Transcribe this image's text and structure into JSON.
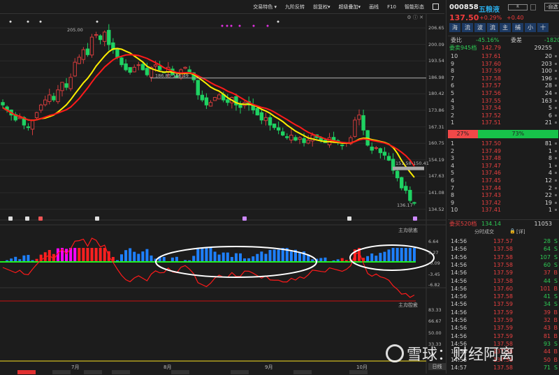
{
  "toolbar": {
    "items": [
      "交易特色 ▾",
      "九阶反转",
      "前复权▾",
      "超级叠加▾",
      "画线",
      "F10",
      "智能形态"
    ]
  },
  "quote": {
    "code": "000858",
    "name": "五粮液",
    "price": "137.50",
    "pct": "+0.29%",
    "change": "+0.40",
    "add_btn": "-自选",
    "btn_r": "R",
    "tabs": [
      "海",
      "流",
      "波",
      "流",
      "主",
      "捕",
      "小",
      "十"
    ],
    "weibi_label": "委比",
    "weibi": "-45.16%",
    "weicha_label": "委差",
    "weicha": "-1820",
    "sell_total_label": "委卖945档",
    "sell_total_price": "142.79",
    "sell_total_vol": "29255",
    "asks": [
      [
        "10",
        "137.61",
        "20"
      ],
      [
        "9",
        "137.60",
        "203"
      ],
      [
        "8",
        "137.59",
        "100"
      ],
      [
        "7",
        "137.58",
        "196"
      ],
      [
        "6",
        "137.57",
        "28"
      ],
      [
        "5",
        "137.56",
        "24"
      ],
      [
        "4",
        "137.55",
        "163"
      ],
      [
        "3",
        "137.54",
        "5"
      ],
      [
        "2",
        "137.52",
        "6"
      ],
      [
        "1",
        "137.51",
        "21"
      ]
    ],
    "ratio_sell": "27%",
    "ratio_buy": "73%",
    "ratio_sell_value": 27,
    "bids": [
      [
        "1",
        "137.50",
        "81"
      ],
      [
        "2",
        "137.49",
        "1"
      ],
      [
        "3",
        "137.48",
        "8"
      ],
      [
        "4",
        "137.47",
        "1"
      ],
      [
        "5",
        "137.46",
        "4"
      ],
      [
        "6",
        "137.45",
        "12"
      ],
      [
        "7",
        "137.44",
        "2"
      ],
      [
        "8",
        "137.43",
        "22"
      ],
      [
        "9",
        "137.42",
        "19"
      ],
      [
        "10",
        "137.41",
        "1"
      ]
    ],
    "buy_total_label": "委买520档",
    "buy_total_price": "134.14",
    "buy_total_vol": "11053",
    "trades_title": "分时成交",
    "trades_detail": "[详]",
    "trades": [
      [
        "14:56",
        "137.57",
        "28",
        "S"
      ],
      [
        "14:56",
        "137.58",
        "64",
        "S"
      ],
      [
        "14:56",
        "137.58",
        "107",
        "S"
      ],
      [
        "14:56",
        "137.58",
        "60",
        "S"
      ],
      [
        "14:56",
        "137.59",
        "37",
        "B"
      ],
      [
        "14:56",
        "137.58",
        "44",
        "S"
      ],
      [
        "14:56",
        "137.60",
        "101",
        "B"
      ],
      [
        "14:56",
        "137.58",
        "41",
        "S"
      ],
      [
        "14:56",
        "137.59",
        "34",
        "S"
      ],
      [
        "14:56",
        "137.59",
        "39",
        "B"
      ],
      [
        "14:56",
        "137.59",
        "32",
        "B"
      ],
      [
        "14:56",
        "137.59",
        "43",
        "B"
      ],
      [
        "14:56",
        "137.59",
        "81",
        "B"
      ],
      [
        "14:56",
        "137.58",
        "93",
        "S"
      ],
      [
        "14:56",
        "137.58",
        "44",
        "B"
      ],
      [
        "14:56",
        "137.58",
        "50",
        "B"
      ],
      [
        "14:57",
        "137.58",
        "71",
        "S"
      ]
    ]
  },
  "chart_data": {
    "type": "candlestick",
    "price_axis": [
      "206.65",
      "200.09",
      "193.54",
      "186.98",
      "180.42",
      "173.86",
      "167.31",
      "160.75",
      "154.19",
      "147.63",
      "141.08",
      "134.52"
    ],
    "ylim": [
      134.52,
      206.65
    ],
    "closes": [
      176,
      174,
      172,
      170,
      171,
      168,
      167,
      170,
      173,
      176,
      178,
      180,
      178,
      182,
      185,
      183,
      187,
      193,
      195,
      198,
      196,
      203,
      204,
      202,
      205,
      200,
      198,
      195,
      192,
      190,
      189,
      191,
      192,
      190,
      188,
      191,
      192,
      190,
      189,
      191,
      188,
      187,
      190,
      191,
      189,
      186,
      180,
      178,
      176,
      177,
      179,
      180,
      178,
      177,
      179,
      176,
      175,
      177,
      176,
      174,
      172,
      170,
      171,
      168,
      167,
      166,
      164,
      163,
      164,
      162,
      163,
      161,
      162,
      164,
      163,
      162,
      161,
      163,
      162,
      161,
      160,
      161,
      163,
      170,
      172,
      166,
      160,
      158,
      159,
      157,
      156,
      154,
      150,
      147,
      143,
      142,
      138,
      137
    ],
    "annotations": {
      "high": "205.00",
      "zone1": "186.85-186.49",
      "zone2": "151.58-150.41",
      "low": "136.17"
    },
    "months": [
      "7月",
      "8月",
      "9月",
      "10月"
    ],
    "period": "日线",
    "ind1": {
      "title": "主力状态",
      "axis": [
        "6.64",
        "3.27",
        "-0.09",
        "-3.45",
        "-6.82"
      ]
    },
    "ind2": {
      "title": "主力控盘",
      "axis": [
        "83.33",
        "66.67",
        "50.00",
        "33.33"
      ]
    }
  },
  "watermark": "雪球：财经阿离"
}
